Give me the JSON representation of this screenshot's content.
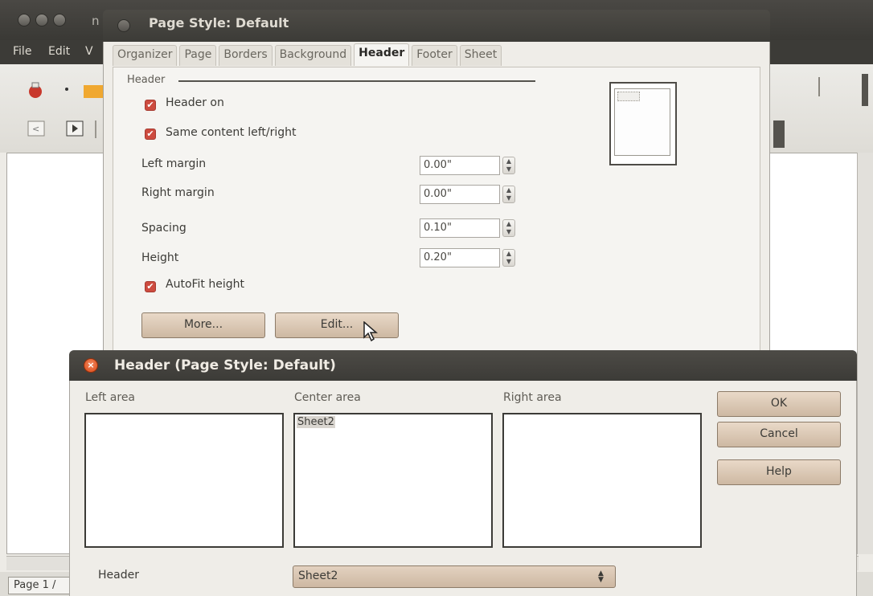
{
  "app": {
    "title_fragment": "n",
    "menu": [
      {
        "label": "File"
      },
      {
        "label": "Edit"
      },
      {
        "label": "V"
      }
    ],
    "status": {
      "page": "Page 1 /"
    }
  },
  "page_style_dialog": {
    "title": "Page Style: Default",
    "tabs": [
      {
        "label": "Organizer",
        "active": false
      },
      {
        "label": "Page",
        "active": false
      },
      {
        "label": "Borders",
        "active": false
      },
      {
        "label": "Background",
        "active": false
      },
      {
        "label": "Header",
        "active": true
      },
      {
        "label": "Footer",
        "active": false
      },
      {
        "label": "Sheet",
        "active": false
      }
    ],
    "group_label": "Header",
    "header_on": {
      "label": "Header on",
      "checked": true
    },
    "same_content": {
      "label": "Same content left/right",
      "checked": true
    },
    "left_margin": {
      "label": "Left margin",
      "value": "0.00\""
    },
    "right_margin": {
      "label": "Right margin",
      "value": "0.00\""
    },
    "spacing": {
      "label": "Spacing",
      "value": "0.10\""
    },
    "height": {
      "label": "Height",
      "value": "0.20\""
    },
    "autofit": {
      "label": "AutoFit height",
      "checked": true
    },
    "more_button": "More...",
    "edit_button": "Edit..."
  },
  "header_dialog": {
    "title": "Header (Page Style: Default)",
    "left_area": {
      "label": "Left area",
      "content": ""
    },
    "center_area": {
      "label": "Center area",
      "content": "Sheet2"
    },
    "right_area": {
      "label": "Right area",
      "content": ""
    },
    "ok_button": "OK",
    "cancel_button": "Cancel",
    "help_button": "Help",
    "header_field_label": "Header",
    "header_select_value": "Sheet2"
  },
  "colors": {
    "titlebar": "#3c3b37",
    "accent_button": "#cdb8a2",
    "checkbox": "#cd4b3f",
    "close_button": "#dd4814"
  }
}
